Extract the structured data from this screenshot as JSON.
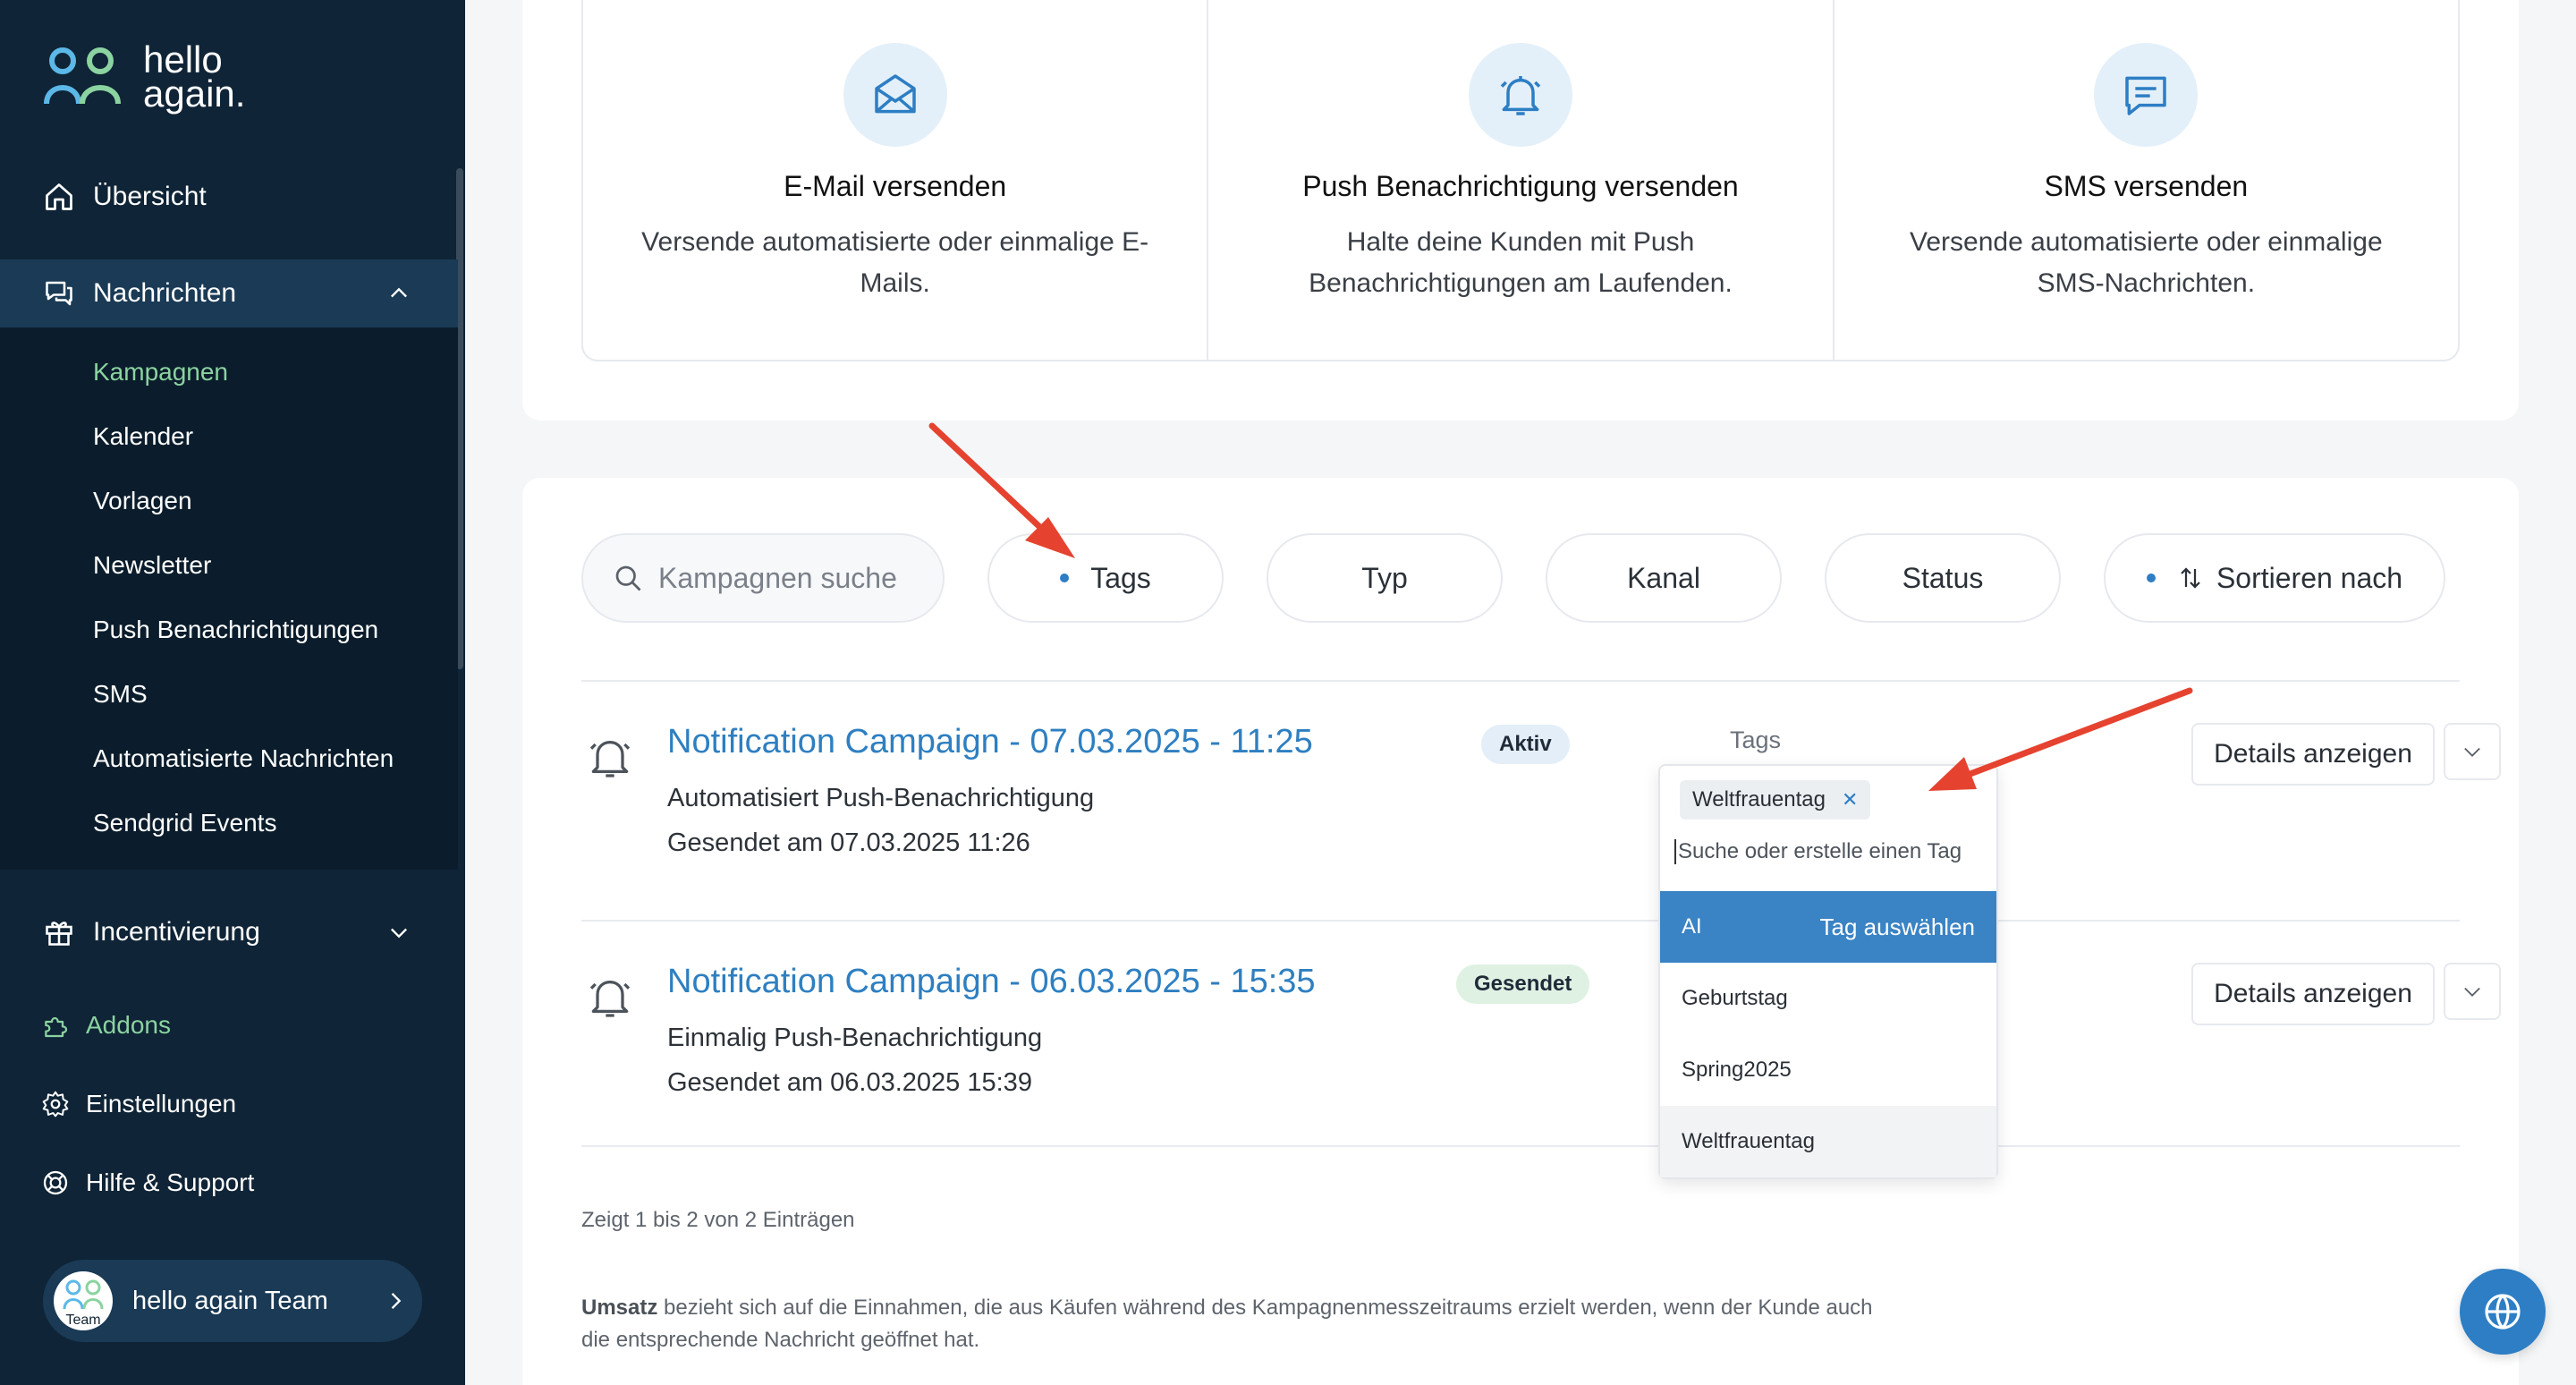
{
  "brand": {
    "line1": "hello",
    "line2": "again."
  },
  "sidebar": {
    "overview": "Übersicht",
    "messages": "Nachrichten",
    "sub_items": [
      "Kampagnen",
      "Kalender",
      "Vorlagen",
      "Newsletter",
      "Push Benachrichtigungen",
      "SMS",
      "Automatisierte Nachrichten",
      "Sendgrid Events"
    ],
    "incentives": "Incentivierung",
    "addons": "Addons",
    "settings": "Einstellungen",
    "help": "Hilfe & Support",
    "user": {
      "name": "hello again Team",
      "avatar_text": "Team"
    }
  },
  "channels": [
    {
      "title": "E-Mail versenden",
      "desc": "Versende automatisierte oder einmalige E-Mails.",
      "icon": "envelope-icon"
    },
    {
      "title": "Push Benachrichtigung versenden",
      "desc": "Halte deine Kunden mit Push Benachrichtigungen am Laufenden.",
      "icon": "bell-icon"
    },
    {
      "title": "SMS versenden",
      "desc": "Versende automatisierte oder einmalige SMS-Nachrichten.",
      "icon": "message-icon"
    }
  ],
  "filters": {
    "search_placeholder": "Kampagnen suche",
    "tags": "Tags",
    "type": "Typ",
    "channel": "Kanal",
    "status": "Status",
    "sort": "Sortieren nach"
  },
  "campaigns": [
    {
      "title": "Notification Campaign - 07.03.2025 - 11:25",
      "type": "Automatisiert Push-Benachrichtigung",
      "sent_label": "Gesendet am",
      "sent_at": "07.03.2025 11:26",
      "status": "Aktiv",
      "tags_label": "Tags",
      "details": "Details anzeigen"
    },
    {
      "title": "Notification Campaign - 06.03.2025 - 15:35",
      "type": "Einmalig Push-Benachrichtigung",
      "sent_label": "Gesendet am",
      "sent_at": "06.03.2025 15:39",
      "status": "Gesendet",
      "details": "Details anzeigen"
    }
  ],
  "tag_dropdown": {
    "selected": "Weltfrauentag",
    "search_placeholder": "Suche oder erstelle einen Tag",
    "options": [
      "AI",
      "Geburtstag",
      "Spring2025",
      "Weltfrauentag"
    ],
    "highlight_hint": "Tag auswählen"
  },
  "footer": {
    "entries": "Zeigt 1 bis 2 von 2 Einträgen",
    "note_bold": "Umsatz",
    "note_text": " bezieht sich auf die Einnahmen, die aus Käufen während des Kampagnenmesszeitraums erzielt werden, wenn der Kunde auch die entsprechende Nachricht geöffnet hat."
  },
  "colors": {
    "sidebar": "#0f2436",
    "accent": "#2d7ec4",
    "active_green": "#8bd3a0",
    "arrow": "#e5432f"
  }
}
